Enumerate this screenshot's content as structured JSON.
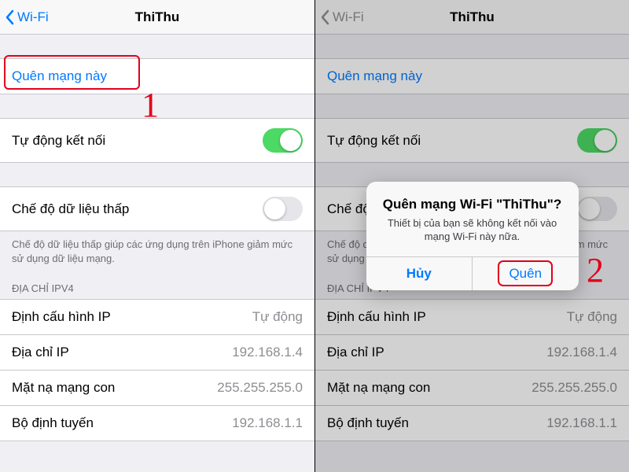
{
  "left": {
    "nav": {
      "back": "Wi-Fi",
      "title": "ThiThu"
    },
    "forget": "Quên mạng này",
    "auto_join": {
      "label": "Tự động kết nối",
      "on": true
    },
    "low_data": {
      "label": "Chế độ dữ liệu thấp",
      "on": false
    },
    "low_data_footer": "Chế độ dữ liệu thấp giúp các ứng dụng trên iPhone giảm mức sử dụng dữ liệu mạng.",
    "ipv4_header": "ĐỊA CHỈ IPV4",
    "ipv4": [
      {
        "label": "Định cấu hình IP",
        "value": "Tự động"
      },
      {
        "label": "Địa chỉ IP",
        "value": "192.168.1.4"
      },
      {
        "label": "Mặt nạ mạng con",
        "value": "255.255.255.0"
      },
      {
        "label": "Bộ định tuyến",
        "value": "192.168.1.1"
      }
    ],
    "step": "1"
  },
  "right": {
    "nav": {
      "back": "Wi-Fi",
      "title": "ThiThu"
    },
    "forget": "Quên mạng này",
    "auto_join": {
      "label": "Tự động kết nối",
      "on": true
    },
    "low_data": {
      "label": "Chế độ dữ liệu thấp",
      "on": false
    },
    "low_data_footer_partial1": "Chế",
    "low_data_footer_partial2": "giảm\nmức",
    "ipv4_header": "ĐỊA CHỈ IPV4",
    "ipv4": [
      {
        "label": "Định cấu hình IP",
        "value": "Tự động"
      },
      {
        "label": "Địa chỉ IP",
        "value": "192.168.1.4"
      },
      {
        "label": "Mặt nạ mạng con",
        "value": "255.255.255.0"
      },
      {
        "label": "Bộ định tuyến",
        "value": "192.168.1.1"
      }
    ],
    "alert": {
      "title": "Quên mạng Wi-Fi \"ThiThu\"?",
      "message": "Thiết bị của bạn sẽ không kết nối vào mạng Wi-Fi này nữa.",
      "cancel": "Hủy",
      "confirm": "Quên"
    },
    "step": "2"
  }
}
